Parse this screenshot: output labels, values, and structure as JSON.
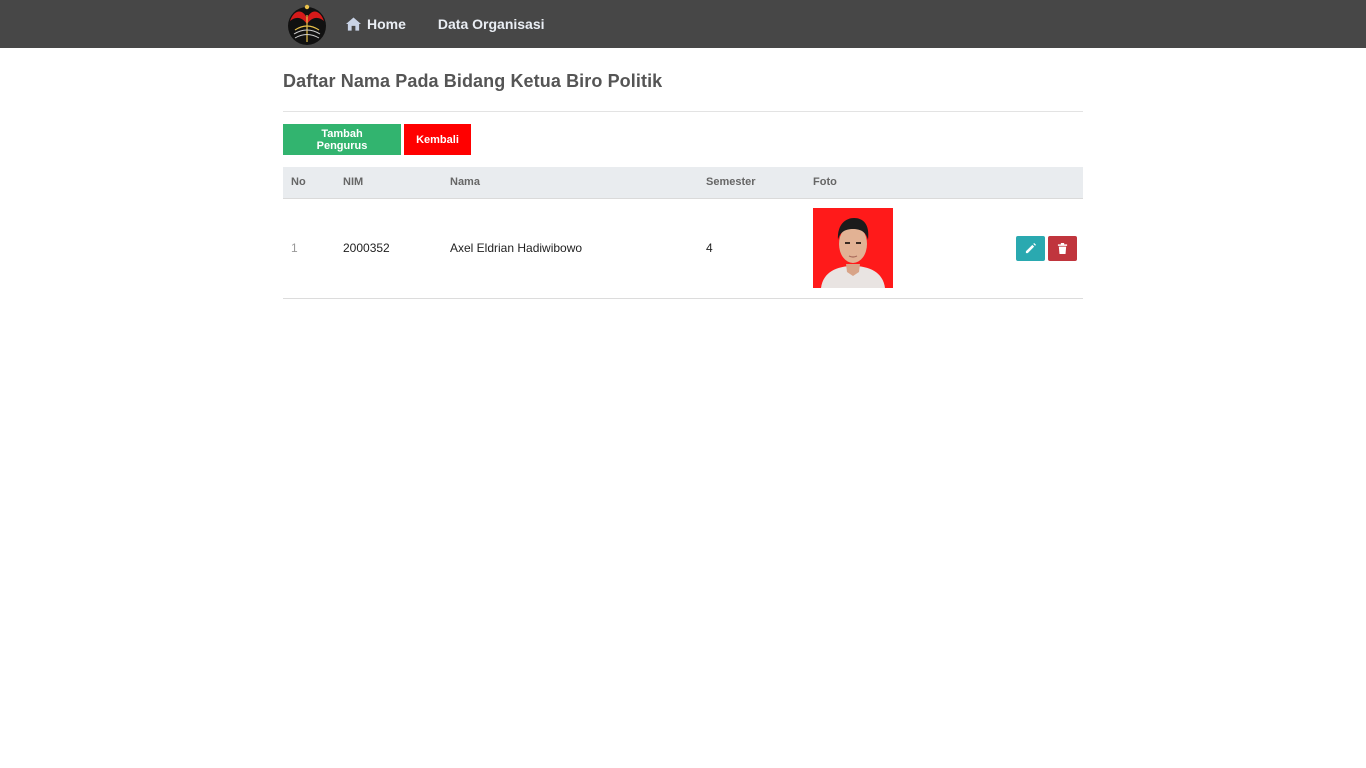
{
  "navbar": {
    "logo_icon": "university-logo-icon",
    "links": [
      {
        "label": "Home",
        "icon": "home-icon"
      },
      {
        "label": "Data Organisasi"
      }
    ]
  },
  "page": {
    "title": "Daftar Nama Pada Bidang Ketua Biro Politik"
  },
  "buttons": {
    "add": "Tambah Pengurus",
    "back": "Kembali"
  },
  "table": {
    "headers": [
      "No",
      "NIM",
      "Nama",
      "Semester",
      "Foto"
    ],
    "rows": [
      {
        "no": "1",
        "nim": "2000352",
        "nama": "Axel Eldrian Hadiwibowo",
        "semester": "4",
        "photo": "member-photo",
        "actions": [
          "edit-icon",
          "trash-icon"
        ]
      }
    ]
  },
  "colors": {
    "navbar_bg": "#474747",
    "add_button": "#32b46f",
    "back_button": "#ff0000",
    "edit_button": "#2aa9b0",
    "delete_button": "#c0353d"
  }
}
